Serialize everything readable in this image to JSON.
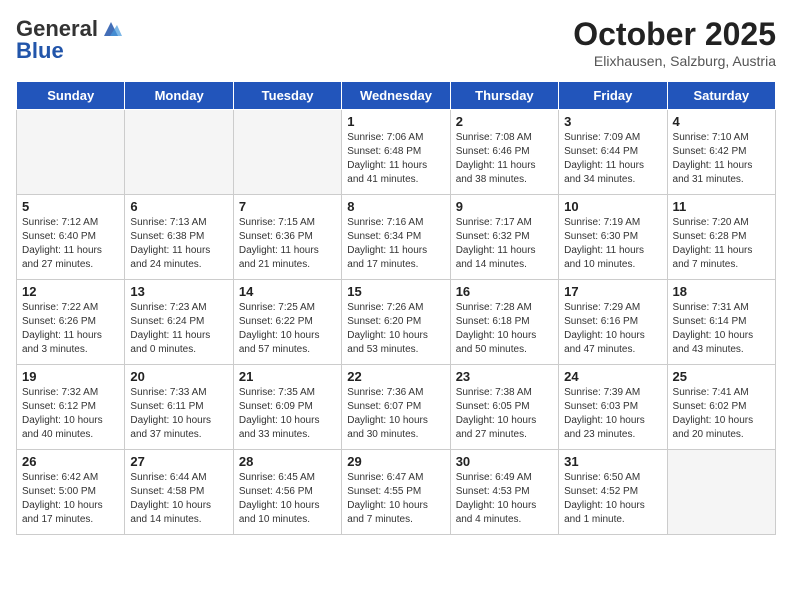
{
  "header": {
    "logo_general": "General",
    "logo_blue": "Blue",
    "month": "October 2025",
    "location": "Elixhausen, Salzburg, Austria"
  },
  "weekdays": [
    "Sunday",
    "Monday",
    "Tuesday",
    "Wednesday",
    "Thursday",
    "Friday",
    "Saturday"
  ],
  "weeks": [
    [
      {
        "day": "",
        "info": ""
      },
      {
        "day": "",
        "info": ""
      },
      {
        "day": "",
        "info": ""
      },
      {
        "day": "1",
        "info": "Sunrise: 7:06 AM\nSunset: 6:48 PM\nDaylight: 11 hours\nand 41 minutes."
      },
      {
        "day": "2",
        "info": "Sunrise: 7:08 AM\nSunset: 6:46 PM\nDaylight: 11 hours\nand 38 minutes."
      },
      {
        "day": "3",
        "info": "Sunrise: 7:09 AM\nSunset: 6:44 PM\nDaylight: 11 hours\nand 34 minutes."
      },
      {
        "day": "4",
        "info": "Sunrise: 7:10 AM\nSunset: 6:42 PM\nDaylight: 11 hours\nand 31 minutes."
      }
    ],
    [
      {
        "day": "5",
        "info": "Sunrise: 7:12 AM\nSunset: 6:40 PM\nDaylight: 11 hours\nand 27 minutes."
      },
      {
        "day": "6",
        "info": "Sunrise: 7:13 AM\nSunset: 6:38 PM\nDaylight: 11 hours\nand 24 minutes."
      },
      {
        "day": "7",
        "info": "Sunrise: 7:15 AM\nSunset: 6:36 PM\nDaylight: 11 hours\nand 21 minutes."
      },
      {
        "day": "8",
        "info": "Sunrise: 7:16 AM\nSunset: 6:34 PM\nDaylight: 11 hours\nand 17 minutes."
      },
      {
        "day": "9",
        "info": "Sunrise: 7:17 AM\nSunset: 6:32 PM\nDaylight: 11 hours\nand 14 minutes."
      },
      {
        "day": "10",
        "info": "Sunrise: 7:19 AM\nSunset: 6:30 PM\nDaylight: 11 hours\nand 10 minutes."
      },
      {
        "day": "11",
        "info": "Sunrise: 7:20 AM\nSunset: 6:28 PM\nDaylight: 11 hours\nand 7 minutes."
      }
    ],
    [
      {
        "day": "12",
        "info": "Sunrise: 7:22 AM\nSunset: 6:26 PM\nDaylight: 11 hours\nand 3 minutes."
      },
      {
        "day": "13",
        "info": "Sunrise: 7:23 AM\nSunset: 6:24 PM\nDaylight: 11 hours\nand 0 minutes."
      },
      {
        "day": "14",
        "info": "Sunrise: 7:25 AM\nSunset: 6:22 PM\nDaylight: 10 hours\nand 57 minutes."
      },
      {
        "day": "15",
        "info": "Sunrise: 7:26 AM\nSunset: 6:20 PM\nDaylight: 10 hours\nand 53 minutes."
      },
      {
        "day": "16",
        "info": "Sunrise: 7:28 AM\nSunset: 6:18 PM\nDaylight: 10 hours\nand 50 minutes."
      },
      {
        "day": "17",
        "info": "Sunrise: 7:29 AM\nSunset: 6:16 PM\nDaylight: 10 hours\nand 47 minutes."
      },
      {
        "day": "18",
        "info": "Sunrise: 7:31 AM\nSunset: 6:14 PM\nDaylight: 10 hours\nand 43 minutes."
      }
    ],
    [
      {
        "day": "19",
        "info": "Sunrise: 7:32 AM\nSunset: 6:12 PM\nDaylight: 10 hours\nand 40 minutes."
      },
      {
        "day": "20",
        "info": "Sunrise: 7:33 AM\nSunset: 6:11 PM\nDaylight: 10 hours\nand 37 minutes."
      },
      {
        "day": "21",
        "info": "Sunrise: 7:35 AM\nSunset: 6:09 PM\nDaylight: 10 hours\nand 33 minutes."
      },
      {
        "day": "22",
        "info": "Sunrise: 7:36 AM\nSunset: 6:07 PM\nDaylight: 10 hours\nand 30 minutes."
      },
      {
        "day": "23",
        "info": "Sunrise: 7:38 AM\nSunset: 6:05 PM\nDaylight: 10 hours\nand 27 minutes."
      },
      {
        "day": "24",
        "info": "Sunrise: 7:39 AM\nSunset: 6:03 PM\nDaylight: 10 hours\nand 23 minutes."
      },
      {
        "day": "25",
        "info": "Sunrise: 7:41 AM\nSunset: 6:02 PM\nDaylight: 10 hours\nand 20 minutes."
      }
    ],
    [
      {
        "day": "26",
        "info": "Sunrise: 6:42 AM\nSunset: 5:00 PM\nDaylight: 10 hours\nand 17 minutes."
      },
      {
        "day": "27",
        "info": "Sunrise: 6:44 AM\nSunset: 4:58 PM\nDaylight: 10 hours\nand 14 minutes."
      },
      {
        "day": "28",
        "info": "Sunrise: 6:45 AM\nSunset: 4:56 PM\nDaylight: 10 hours\nand 10 minutes."
      },
      {
        "day": "29",
        "info": "Sunrise: 6:47 AM\nSunset: 4:55 PM\nDaylight: 10 hours\nand 7 minutes."
      },
      {
        "day": "30",
        "info": "Sunrise: 6:49 AM\nSunset: 4:53 PM\nDaylight: 10 hours\nand 4 minutes."
      },
      {
        "day": "31",
        "info": "Sunrise: 6:50 AM\nSunset: 4:52 PM\nDaylight: 10 hours\nand 1 minute."
      },
      {
        "day": "",
        "info": ""
      }
    ]
  ]
}
